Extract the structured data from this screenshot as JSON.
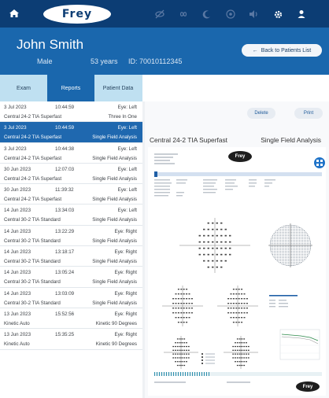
{
  "app": {
    "logo_text": "Frey"
  },
  "nav": {
    "icons": [
      "home-icon",
      "visibility-off-icon",
      "infinity-icon",
      "moon-icon",
      "target-icon",
      "volume-icon",
      "gear-icon",
      "user-icon"
    ],
    "active_color": "#ffffff",
    "inactive_color": "#5a78a3"
  },
  "patient": {
    "name": "John  Smith",
    "gender": "Male",
    "age": "53 years",
    "id": "ID: 70010112345",
    "back_button": "Back to Patients List"
  },
  "tabs": [
    "Exam",
    "Reports",
    "Patient Data"
  ],
  "active_tab": 1,
  "exams": [
    {
      "date": "3 Jul 2023",
      "time": "10:44:59",
      "eye": "Eye: Left",
      "program": "Central 24-2 TIA Superfast",
      "mode": "Three In One",
      "selected": false
    },
    {
      "date": "3 Jul 2023",
      "time": "10:44:59",
      "eye": "Eye: Left",
      "program": "Central 24-2 TIA Superfast",
      "mode": "Single Field Analysis",
      "selected": true
    },
    {
      "date": "3 Jul 2023",
      "time": "10:44:38",
      "eye": "Eye: Left",
      "program": "Central 24-2 TIA Superfast",
      "mode": "Single Field Analysis",
      "selected": false
    },
    {
      "date": "30 Jun 2023",
      "time": "12:07:03",
      "eye": "Eye: Left",
      "program": "Central 24-2 TIA Superfast",
      "mode": "Single Field Analysis",
      "selected": false
    },
    {
      "date": "30 Jun 2023",
      "time": "11:39:32",
      "eye": "Eye: Left",
      "program": "Central 24-2 TIA Superfast",
      "mode": "Single Field Analysis",
      "selected": false
    },
    {
      "date": "14 Jun 2023",
      "time": "13:34:03",
      "eye": "Eye: Left",
      "program": "Central 30-2 TIA Standard",
      "mode": "Single Field Analysis",
      "selected": false
    },
    {
      "date": "14 Jun 2023",
      "time": "13:22:29",
      "eye": "Eye: Right",
      "program": "Central 30-2 TIA Standard",
      "mode": "Single Field Analysis",
      "selected": false
    },
    {
      "date": "14 Jun 2023",
      "time": "13:18:17",
      "eye": "Eye: Right",
      "program": "Central 30-2 TIA Standard",
      "mode": "Single Field Analysis",
      "selected": false
    },
    {
      "date": "14 Jun 2023",
      "time": "13:05:24",
      "eye": "Eye: Right",
      "program": "Central 30-2 TIA Standard",
      "mode": "Single Field Analysis",
      "selected": false
    },
    {
      "date": "14 Jun 2023",
      "time": "13:03:09",
      "eye": "Eye: Right",
      "program": "Central 30-2 TIA Standard",
      "mode": "Single Field Analysis",
      "selected": false
    },
    {
      "date": "13 Jun 2023",
      "time": "15:52:56",
      "eye": "Eye: Right",
      "program": "Kinetic Auto",
      "mode": "Kinetic 90 Degrees",
      "selected": false
    },
    {
      "date": "13 Jun 2023",
      "time": "15:35:25",
      "eye": "Eye: Right",
      "program": "Kinetic Auto",
      "mode": "Kinetic 90 Degrees",
      "selected": false
    }
  ],
  "report": {
    "delete_label": "Delete",
    "print_label": "Print",
    "title": "Central 24-2 TIA Superfast",
    "type": "Single Field Analysis",
    "logo_text": "Frey",
    "fab_icon": "grid-icon"
  },
  "colors": {
    "nav_bg": "#0c3d74",
    "header_bg": "#1a67ad",
    "tabs_bg": "#bfe0f1",
    "selected_row": "#1f68af",
    "accent": "#1f73c8"
  }
}
